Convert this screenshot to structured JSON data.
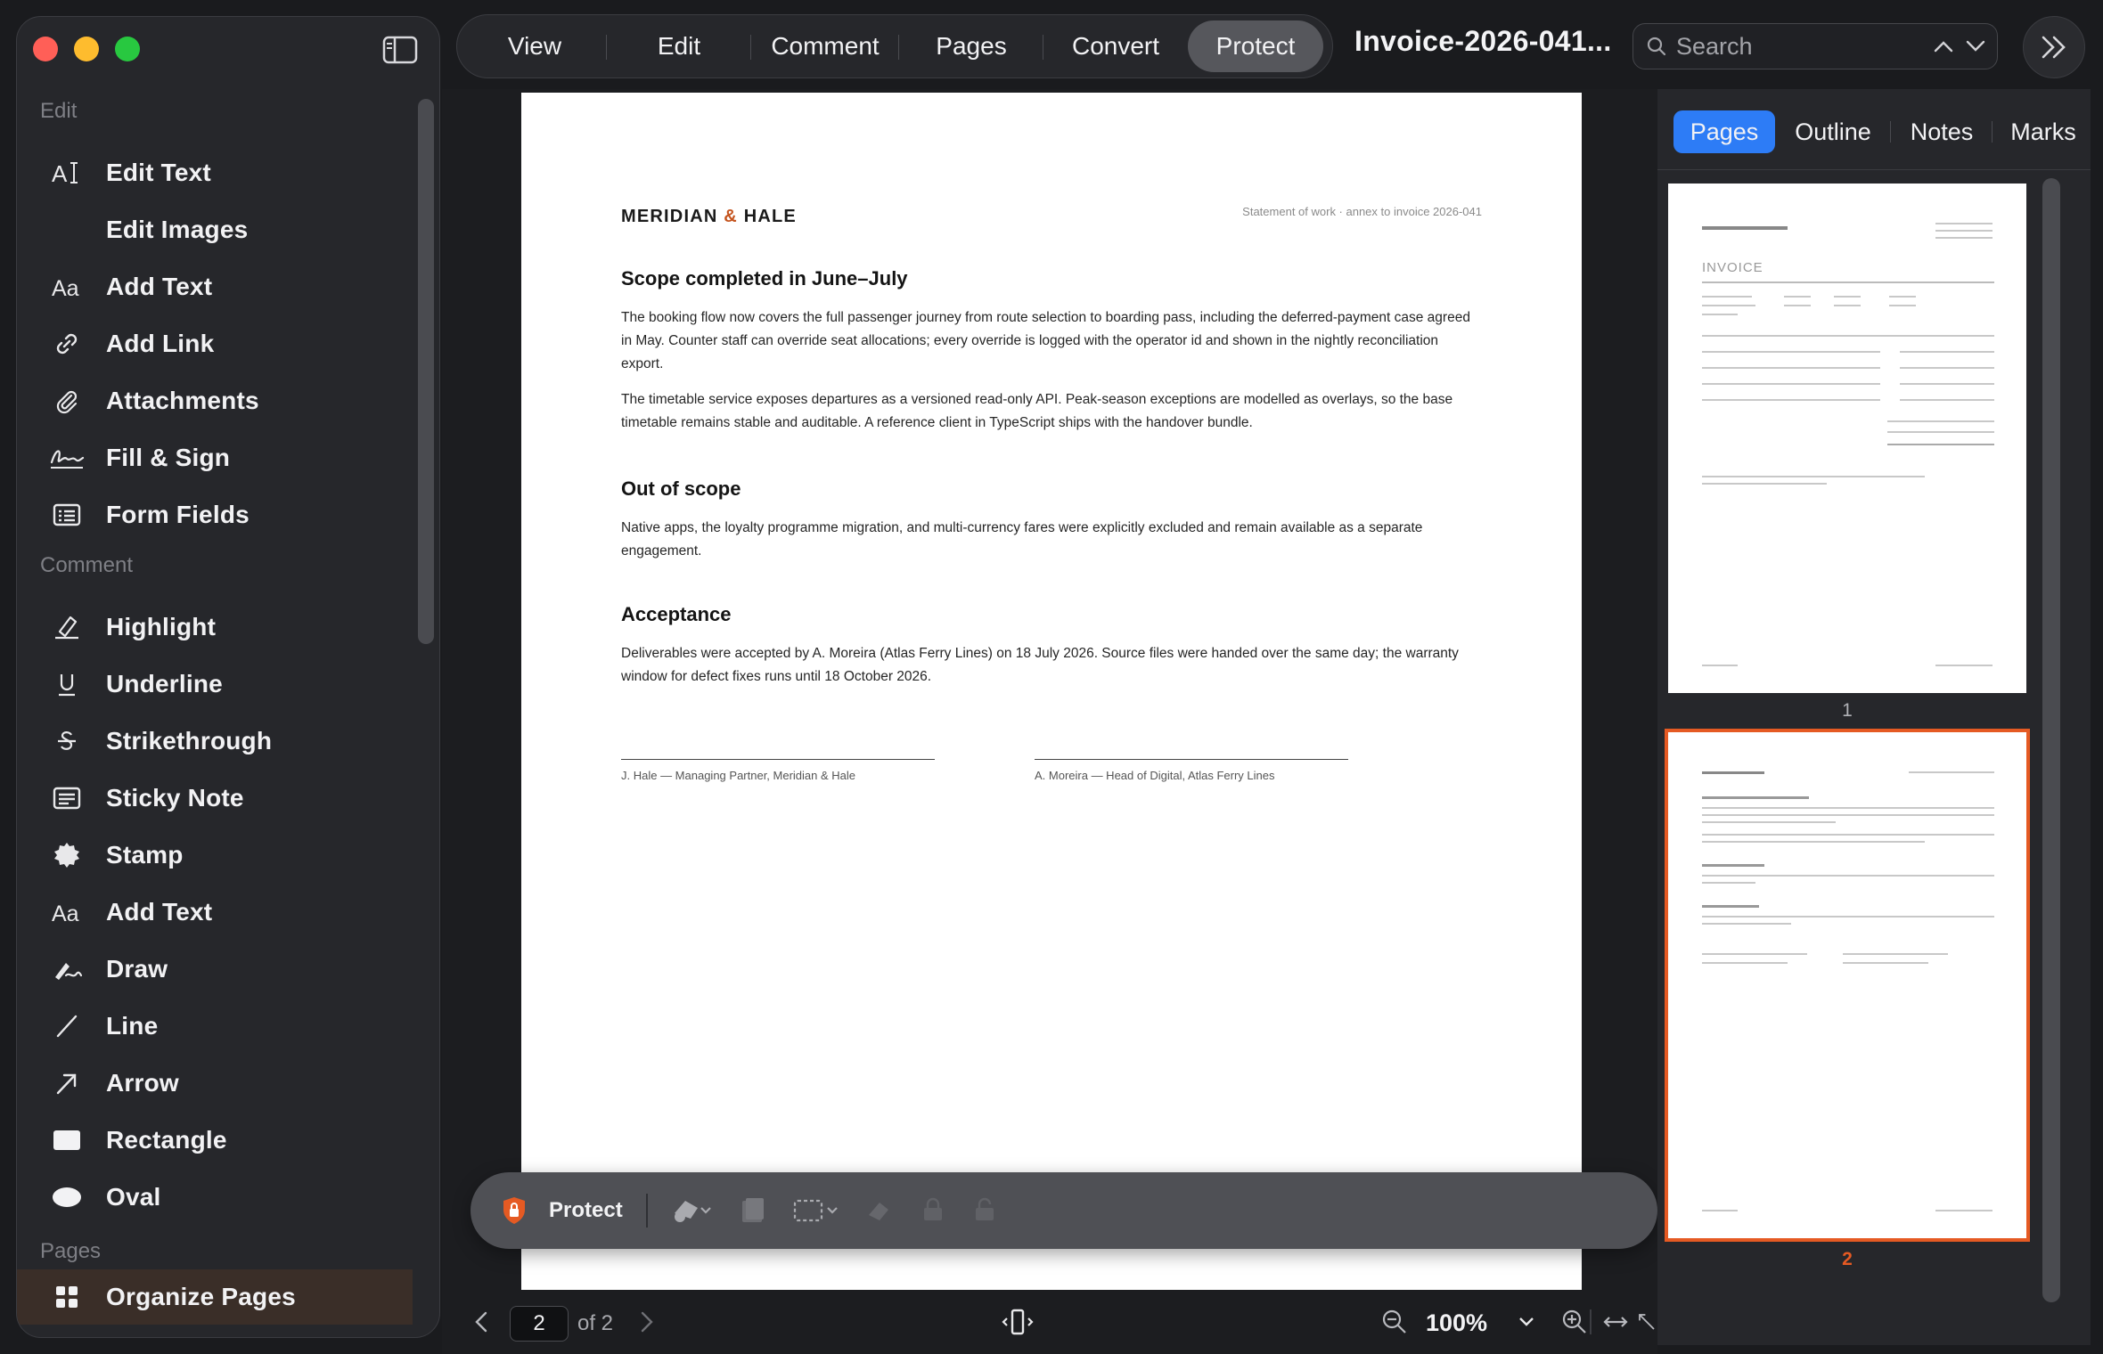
{
  "window": {
    "title": "Invoice-2026-041...",
    "accent": "#2d7cf6",
    "highlight": "#e55a23"
  },
  "sidebar": {
    "sections": [
      {
        "label": "Edit"
      },
      {
        "label": "Comment"
      },
      {
        "label": "Pages"
      }
    ],
    "items": [
      {
        "label": "Edit Text",
        "icon": "edit-text-icon"
      },
      {
        "label": "Edit Images",
        "icon": ""
      },
      {
        "label": "Add Text",
        "icon": "text-aa-icon"
      },
      {
        "label": "Add Link",
        "icon": "link-icon"
      },
      {
        "label": "Attachments",
        "icon": "paperclip-icon"
      },
      {
        "label": "Fill & Sign",
        "icon": "signature-icon"
      },
      {
        "label": "Form Fields",
        "icon": "form-icon"
      },
      {
        "label": "Highlight",
        "icon": "highlighter-icon"
      },
      {
        "label": "Underline",
        "icon": "underline-icon"
      },
      {
        "label": "Strikethrough",
        "icon": "strikethrough-icon"
      },
      {
        "label": "Sticky Note",
        "icon": "note-icon"
      },
      {
        "label": "Stamp",
        "icon": "stamp-icon"
      },
      {
        "label": "Add Text",
        "icon": "text-aa-icon"
      },
      {
        "label": "Draw",
        "icon": "draw-icon"
      },
      {
        "label": "Line",
        "icon": "line-icon"
      },
      {
        "label": "Arrow",
        "icon": "arrow-icon"
      },
      {
        "label": "Rectangle",
        "icon": "rectangle-icon"
      },
      {
        "label": "Oval",
        "icon": "oval-icon"
      },
      {
        "label": "Organize Pages",
        "icon": "grid-icon"
      }
    ]
  },
  "toolbar": {
    "tabs": [
      {
        "label": "View"
      },
      {
        "label": "Edit"
      },
      {
        "label": "Comment"
      },
      {
        "label": "Pages"
      },
      {
        "label": "Convert"
      },
      {
        "label": "Protect"
      }
    ],
    "active_tab": "Protect",
    "search_placeholder": "Search"
  },
  "document": {
    "brand_left": "MERIDIAN",
    "brand_amp": "&",
    "brand_right": "HALE",
    "annex": "Statement of work · annex to invoice 2026-041",
    "sections": [
      {
        "heading": "Scope completed in June–July",
        "paragraphs": [
          "The booking flow now covers the full passenger journey from route selection to boarding pass, including the deferred-payment case agreed in May. Counter staff can override seat allocations; every override is logged with the operator id and shown in the nightly reconciliation export.",
          "The timetable service exposes departures as a versioned read-only API. Peak-season exceptions are modelled as overlays, so the base timetable remains stable and auditable. A reference client in TypeScript ships with the handover bundle."
        ]
      },
      {
        "heading": "Out of scope",
        "paragraphs": [
          "Native apps, the loyalty programme migration, and multi-currency fares were explicitly excluded and remain available as a separate engagement."
        ]
      },
      {
        "heading": "Acceptance",
        "paragraphs": [
          "Deliverables were accepted by A. Moreira (Atlas Ferry Lines) on 18 July 2026. Source files were handed over the same day; the warranty window for defect fixes runs until 18 October 2026."
        ]
      }
    ],
    "signatures": [
      "J. Hale — Managing Partner, Meridian & Hale",
      "A. Moreira — Head of Digital, Atlas Ferry Lines"
    ]
  },
  "protect_bar": {
    "label": "Protect"
  },
  "status": {
    "current_page": "2",
    "of_label": "of 2",
    "zoom": "100%"
  },
  "right_panel": {
    "tabs": [
      {
        "label": "Pages"
      },
      {
        "label": "Outline"
      },
      {
        "label": "Notes"
      },
      {
        "label": "Marks"
      }
    ],
    "active_tab": "Pages",
    "thumbnails": [
      {
        "number": "1",
        "title": "INVOICE"
      },
      {
        "number": "2"
      }
    ]
  }
}
